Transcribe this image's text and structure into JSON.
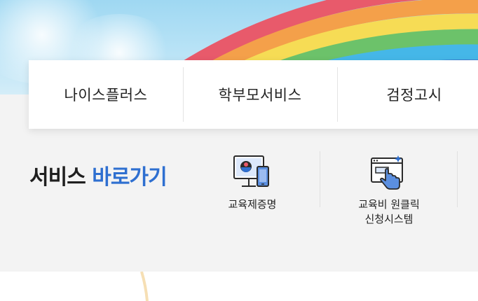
{
  "tabs": [
    {
      "label": "나이스플러스"
    },
    {
      "label": "학부모서비스"
    },
    {
      "label": "검정고시"
    }
  ],
  "quick_links": {
    "title_main": "서비스",
    "title_accent": "바로가기",
    "items": [
      {
        "label": "교육제증명",
        "icon": "monitor-certificate-icon"
      },
      {
        "label": "교육비 원클릭\n신청시스템",
        "icon": "touch-screen-icon"
      }
    ]
  },
  "colors": {
    "accent": "#2e6fd0",
    "rainbow": [
      "#e85a6b",
      "#f4a04a",
      "#f6dc55",
      "#6cc26a",
      "#45b7e8",
      "#3a63c7",
      "#8a4fb0"
    ]
  }
}
